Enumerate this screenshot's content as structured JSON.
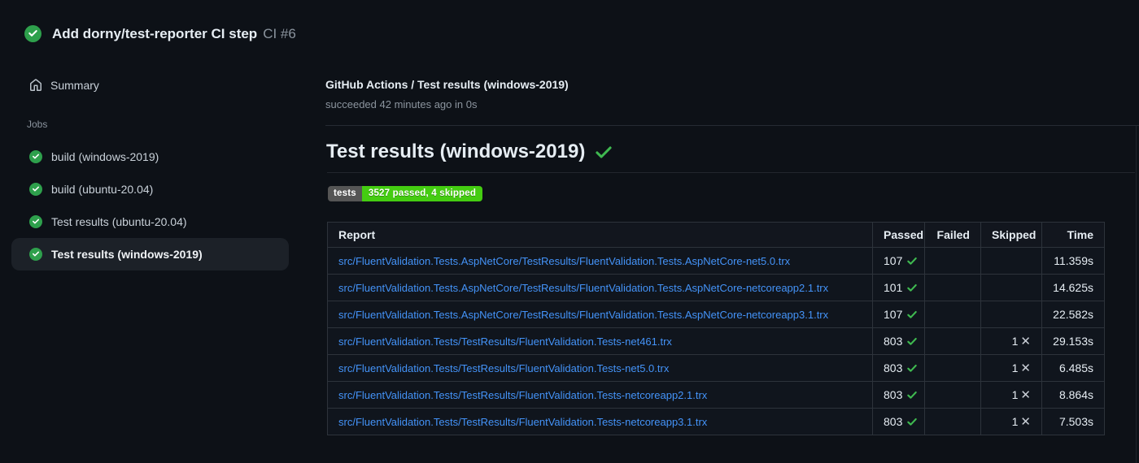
{
  "header": {
    "status_icon": "check-circle-icon",
    "title": "Add dorny/test-reporter CI step",
    "run_label": "CI #6"
  },
  "sidebar": {
    "summary_label": "Summary",
    "jobs_label": "Jobs",
    "jobs": [
      {
        "label": "build (windows-2019)",
        "selected": false
      },
      {
        "label": "build (ubuntu-20.04)",
        "selected": false
      },
      {
        "label": "Test results (ubuntu-20.04)",
        "selected": false
      },
      {
        "label": "Test results (windows-2019)",
        "selected": true
      }
    ]
  },
  "main": {
    "breadcrumb": "GitHub Actions / Test results (windows-2019)",
    "status_line": "succeeded 42 minutes ago in 0s",
    "heading": "Test results (windows-2019)",
    "badge": {
      "label": "tests",
      "value": "3527 passed, 4 skipped"
    },
    "table": {
      "columns": [
        "Report",
        "Passed",
        "Failed",
        "Skipped",
        "Time"
      ],
      "cross_glyph": "✕",
      "rows": [
        {
          "report": "src/FluentValidation.Tests.AspNetCore/TestResults/FluentValidation.Tests.AspNetCore-net5.0.trx",
          "passed": "107",
          "failed": "",
          "skipped": "",
          "time": "11.359s"
        },
        {
          "report": "src/FluentValidation.Tests.AspNetCore/TestResults/FluentValidation.Tests.AspNetCore-netcoreapp2.1.trx",
          "passed": "101",
          "failed": "",
          "skipped": "",
          "time": "14.625s"
        },
        {
          "report": "src/FluentValidation.Tests.AspNetCore/TestResults/FluentValidation.Tests.AspNetCore-netcoreapp3.1.trx",
          "passed": "107",
          "failed": "",
          "skipped": "",
          "time": "22.582s"
        },
        {
          "report": "src/FluentValidation.Tests/TestResults/FluentValidation.Tests-net461.trx",
          "passed": "803",
          "failed": "",
          "skipped": "1",
          "time": "29.153s"
        },
        {
          "report": "src/FluentValidation.Tests/TestResults/FluentValidation.Tests-net5.0.trx",
          "passed": "803",
          "failed": "",
          "skipped": "1",
          "time": "6.485s"
        },
        {
          "report": "src/FluentValidation.Tests/TestResults/FluentValidation.Tests-netcoreapp2.1.trx",
          "passed": "803",
          "failed": "",
          "skipped": "1",
          "time": "8.864s"
        },
        {
          "report": "src/FluentValidation.Tests/TestResults/FluentValidation.Tests-netcoreapp3.1.trx",
          "passed": "803",
          "failed": "",
          "skipped": "1",
          "time": "7.503s"
        }
      ]
    }
  },
  "colors": {
    "success_green": "#3fb950",
    "circle_green": "#2ea04c",
    "link_blue": "#4493f8",
    "badge_label_bg": "#555555",
    "badge_value_bg": "#44cc11"
  }
}
